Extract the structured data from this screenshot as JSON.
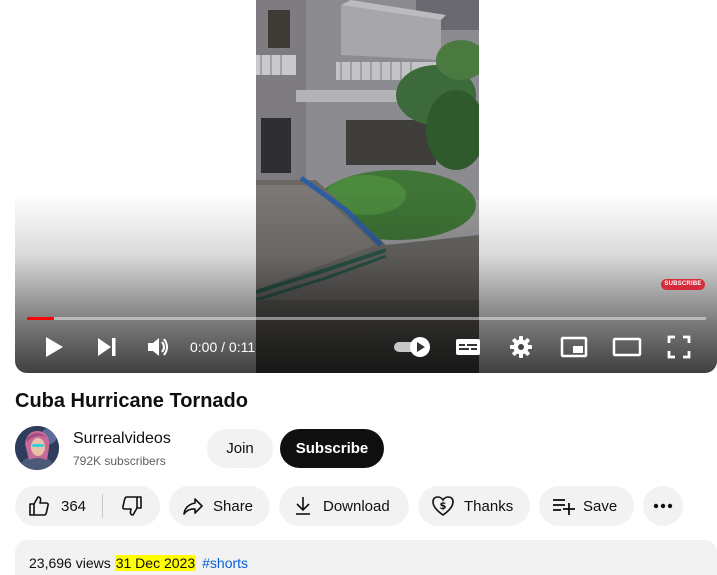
{
  "player": {
    "watermark_label": "SUBSCRIBE",
    "time_display": "0:00 / 0:11",
    "progress_fraction": 0.04,
    "accent_color": "#ff0000"
  },
  "video": {
    "title": "Cuba Hurricane Tornado"
  },
  "channel": {
    "name": "Surrealvideos",
    "subscribers": "792K subscribers",
    "join_label": "Join",
    "subscribe_label": "Subscribe"
  },
  "actions": {
    "like_count": "364",
    "share_label": "Share",
    "download_label": "Download",
    "thanks_label": "Thanks",
    "save_label": "Save"
  },
  "description": {
    "views": "23,696 views",
    "date": "31 Dec 2023",
    "hashtag": "#shorts",
    "date_highlight_color": "#ffff00",
    "link_color": "#065fd4"
  },
  "icons": {
    "play": "play-icon",
    "next": "next-icon",
    "volume": "volume-icon",
    "autoplay": "autoplay-toggle-icon",
    "captions": "captions-icon",
    "settings": "gear-icon",
    "miniplayer": "miniplayer-icon",
    "theater": "theater-icon",
    "fullscreen": "fullscreen-icon",
    "like": "thumbs-up-icon",
    "dislike": "thumbs-down-icon",
    "share": "share-arrow-icon",
    "download": "download-icon",
    "thanks": "heart-dollar-icon",
    "save": "playlist-add-icon",
    "more": "more-horizontal-icon"
  }
}
